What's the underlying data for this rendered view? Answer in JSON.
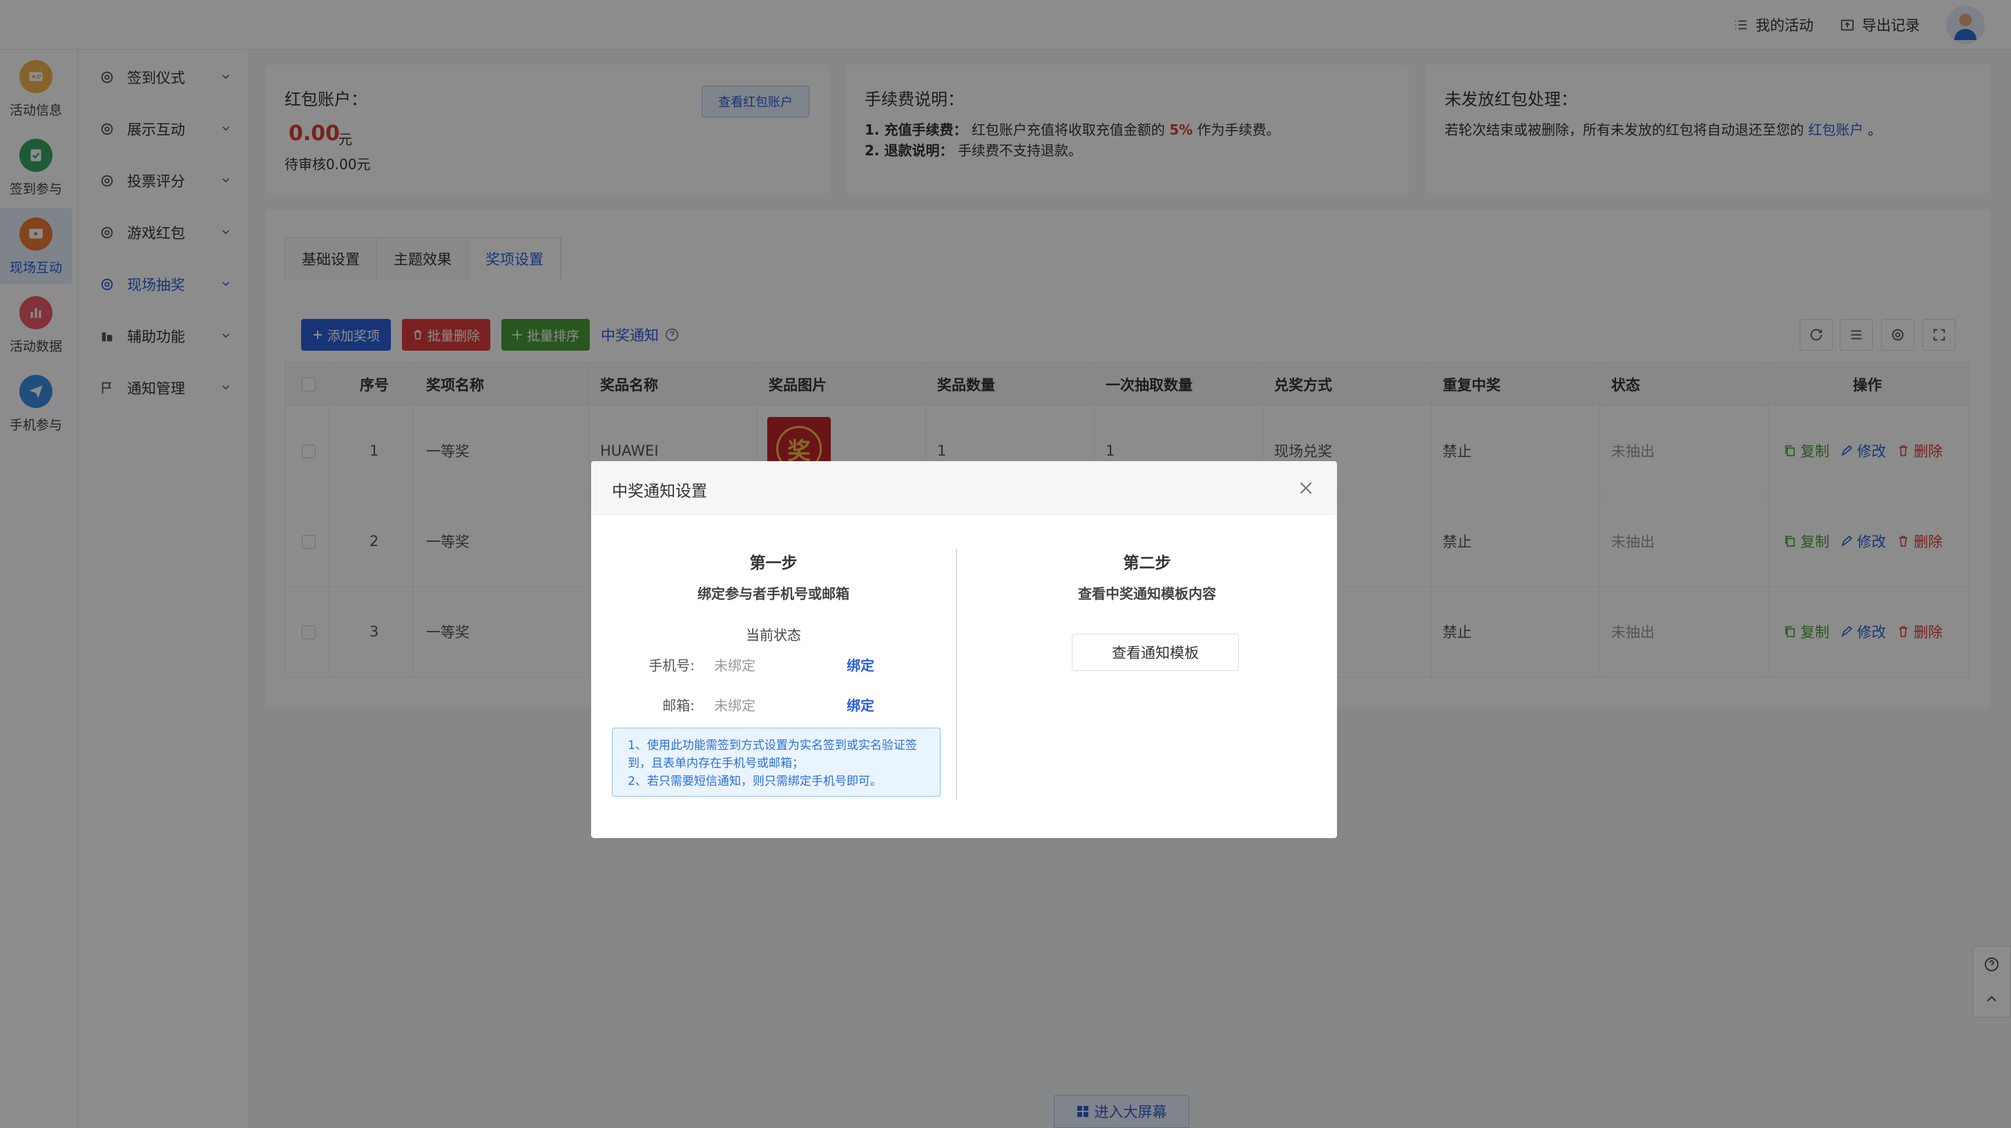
{
  "header": {
    "my_activities": "我的活动",
    "export_records": "导出记录"
  },
  "rail": {
    "items": [
      {
        "label": "活动信息",
        "color": "#e9a23b"
      },
      {
        "label": "签到参与",
        "color": "#3aa564"
      },
      {
        "label": "现场互动",
        "color": "#e0632f"
      },
      {
        "label": "活动数据",
        "color": "#e0455a"
      },
      {
        "label": "手机参与",
        "color": "#2b7fd9"
      }
    ]
  },
  "sidebar": {
    "items": [
      {
        "label": "签到仪式"
      },
      {
        "label": "展示互动"
      },
      {
        "label": "投票评分"
      },
      {
        "label": "游戏红包"
      },
      {
        "label": "现场抽奖"
      },
      {
        "label": "辅助功能"
      },
      {
        "label": "通知管理"
      }
    ]
  },
  "account": {
    "title": "红包账户：",
    "view_button": "查看红包账户",
    "amount": "0.00",
    "unit": "元",
    "pending": "待审核0.00元"
  },
  "fee": {
    "title": "手续费说明：",
    "line1_label": "1. 充值手续费：",
    "line1_text": "红包账户充值将收取充值金额的",
    "line1_rate": "5%",
    "line1_suffix": "作为手续费。",
    "line2_label": "2. 退款说明：",
    "line2_text": "手续费不支持退款。"
  },
  "unsent": {
    "title": "未发放红包处理：",
    "text": "若轮次结束或被删除，所有未发放的红包将自动退还至您的",
    "link": "红包账户",
    "suffix": "。"
  },
  "tabs": [
    {
      "label": "基础设置"
    },
    {
      "label": "主题效果"
    },
    {
      "label": "奖项设置"
    }
  ],
  "toolbar": {
    "add": "添加奖项",
    "batch_delete": "批量删除",
    "batch_sort": "批量排序",
    "notify": "中奖通知"
  },
  "table": {
    "headers": [
      "序号",
      "奖项名称",
      "奖品名称",
      "奖品图片",
      "奖品数量",
      "一次抽取数量",
      "兑奖方式",
      "重复中奖",
      "状态",
      "操作"
    ],
    "rows": [
      {
        "no": "1",
        "award": "一等奖",
        "prize": "HUAWEI",
        "qty": "1",
        "draw": "1",
        "method": "现场兑奖",
        "repeat": "禁止",
        "status": "未抽出"
      },
      {
        "no": "2",
        "award": "一等奖",
        "repeat": "禁止",
        "status": "未抽出"
      },
      {
        "no": "3",
        "award": "一等奖",
        "repeat": "禁止",
        "status": "未抽出"
      }
    ],
    "prize_icon_char": "奖",
    "actions": {
      "copy": "复制",
      "edit": "修改",
      "delete": "删除"
    }
  },
  "modal": {
    "title": "中奖通知设置",
    "step1": "第一步",
    "step1_desc": "绑定参与者手机号或邮箱",
    "current_status": "当前状态",
    "phone_label": "手机号:",
    "phone_value": "未绑定",
    "email_label": "邮箱:",
    "email_value": "未绑定",
    "bind": "绑定",
    "info1": "1、使用此功能需签到方式设置为实名签到或实名验证签到，且表单内存在手机号或邮箱；",
    "info2": "2、若只需要短信通知，则只需绑定手机号即可。",
    "step2": "第二步",
    "step2_desc": "查看中奖通知模板内容",
    "template_button": "查看通知模板"
  },
  "footer": {
    "big_screen": "进入大屏幕"
  },
  "colors": {
    "primary": "#2b5fd9",
    "danger": "#e03b3b",
    "success": "#4a9e38"
  }
}
